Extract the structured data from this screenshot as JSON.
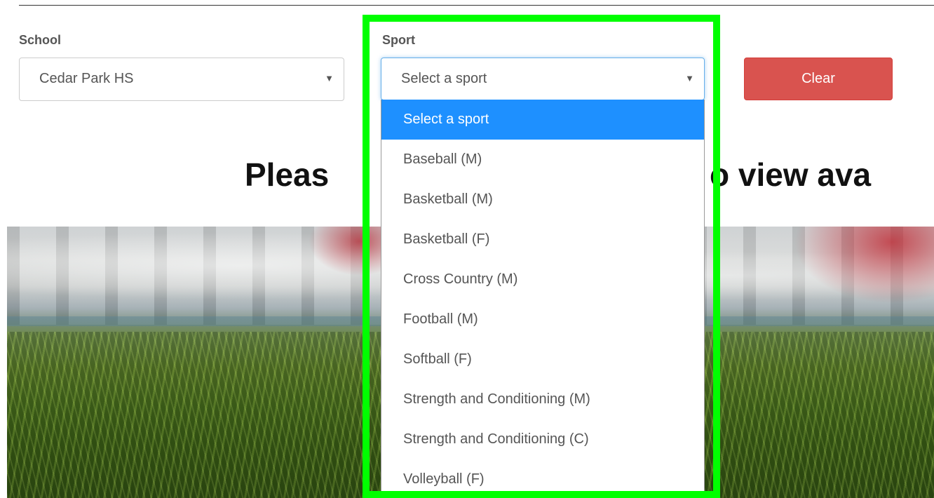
{
  "school": {
    "label": "School",
    "selected": "Cedar Park HS"
  },
  "sport": {
    "label": "Sport",
    "selected": "Select a sport",
    "options": [
      "Select a sport",
      "Baseball (M)",
      "Basketball (M)",
      "Basketball (F)",
      "Cross Country (M)",
      "Football (M)",
      "Softball (F)",
      "Strength and Conditioning (M)",
      "Strength and Conditioning (C)",
      "Volleyball (F)"
    ],
    "highlighted_index": 0
  },
  "actions": {
    "clear_label": "Clear"
  },
  "heading": {
    "left_fragment": "Pleas",
    "right_fragment": "o view ava"
  },
  "icons": {
    "caret": "▼"
  },
  "colors": {
    "clear_button": "#d9534f",
    "option_highlight": "#1e90ff",
    "annotation_frame": "#00ff00"
  }
}
